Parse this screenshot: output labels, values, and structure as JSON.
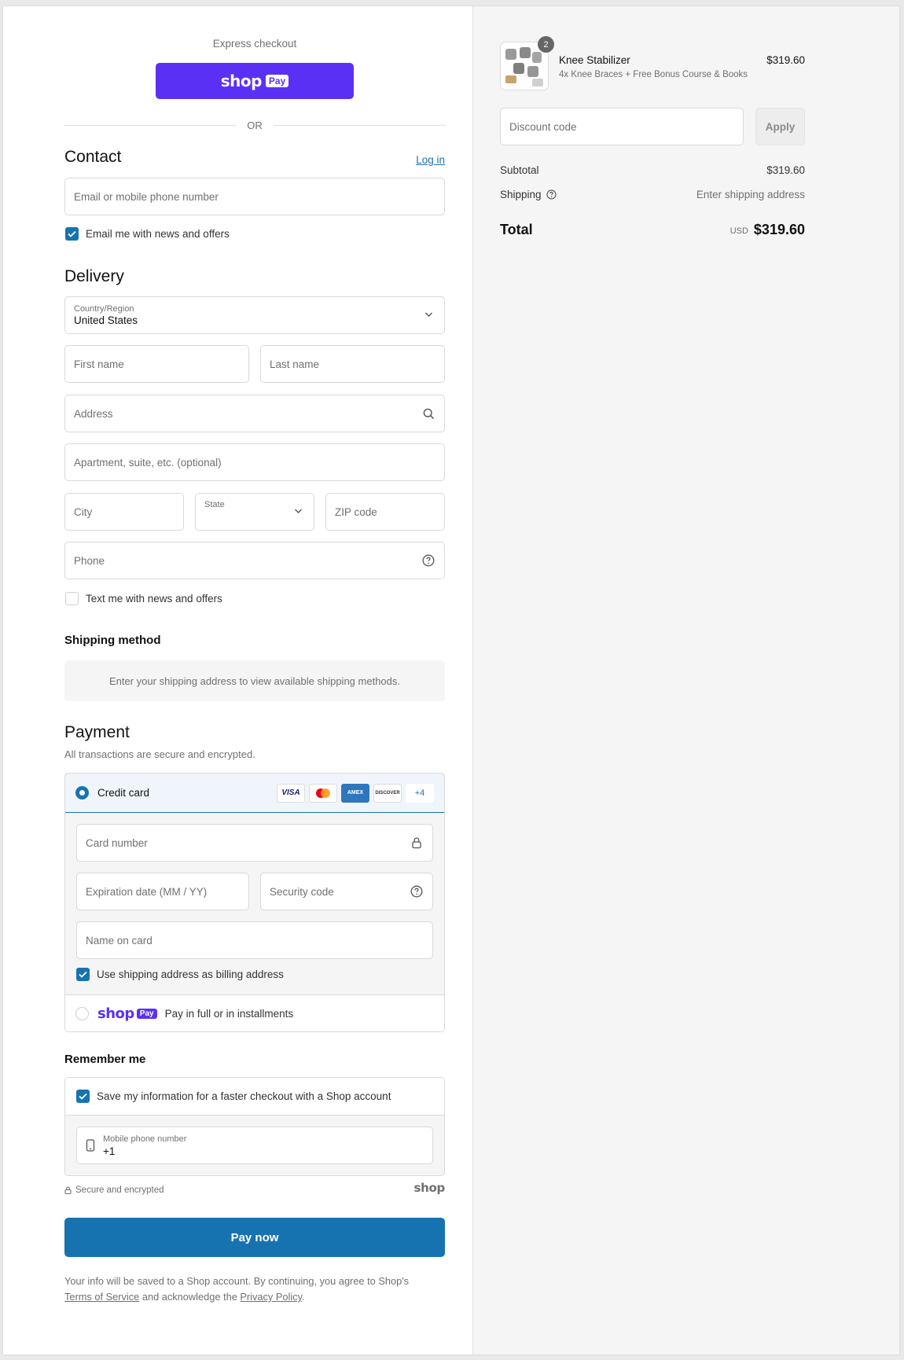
{
  "express": {
    "label": "Express checkout",
    "shop_word": "shop",
    "pay_word": "Pay",
    "or": "OR"
  },
  "contact": {
    "title": "Contact",
    "login_link": "Log in",
    "email_placeholder": "Email or mobile phone number",
    "newsletter_label": "Email me with news and offers",
    "newsletter_checked": true
  },
  "delivery": {
    "title": "Delivery",
    "country_label": "Country/Region",
    "country_value": "United States",
    "first_name": "First name",
    "last_name": "Last name",
    "address": "Address",
    "apartment": "Apartment, suite, etc. (optional)",
    "city": "City",
    "state": "State",
    "zip": "ZIP code",
    "phone": "Phone",
    "sms_label": "Text me with news and offers",
    "sms_checked": false
  },
  "shipping_method": {
    "title": "Shipping method",
    "note": "Enter your shipping address to view available shipping methods."
  },
  "payment": {
    "title": "Payment",
    "subtitle": "All transactions are secure and encrypted.",
    "credit_card_label": "Credit card",
    "cards": [
      "VISA",
      "",
      "AMEX",
      "DISCOVER",
      "+4"
    ],
    "card_number": "Card number",
    "expiration": "Expiration date (MM / YY)",
    "security_code": "Security code",
    "name_on_card": "Name on card",
    "billing_same_label": "Use shipping address as billing address",
    "shoppay_shop": "shop",
    "shoppay_pay": "Pay",
    "shoppay_label": "Pay in full or in installments"
  },
  "remember": {
    "title": "Remember me",
    "save_label": "Save my information for a faster checkout with a Shop account",
    "mobile_label": "Mobile phone number",
    "mobile_value": "+1",
    "secure_label": "Secure and encrypted",
    "shop_mark": "shop"
  },
  "pay_now": "Pay now",
  "legal": {
    "text1": "Your info will be saved to a Shop account. By continuing, you agree to Shop's",
    "terms": "Terms of Service",
    "text2": "and acknowledge the",
    "privacy": "Privacy Policy",
    "text3": "."
  },
  "summary": {
    "product_name": "Knee Stabilizer",
    "product_variant": "4x Knee Braces + Free Bonus Course & Books",
    "product_price": "$319.60",
    "quantity": "2",
    "discount_placeholder": "Discount code",
    "apply": "Apply",
    "subtotal_label": "Subtotal",
    "subtotal_value": "$319.60",
    "shipping_label": "Shipping",
    "shipping_value": "Enter shipping address",
    "total_label": "Total",
    "currency": "USD",
    "total_value": "$319.60"
  },
  "colors": {
    "shop_purple": "#5a31f4",
    "accent_blue": "#1773b0"
  }
}
